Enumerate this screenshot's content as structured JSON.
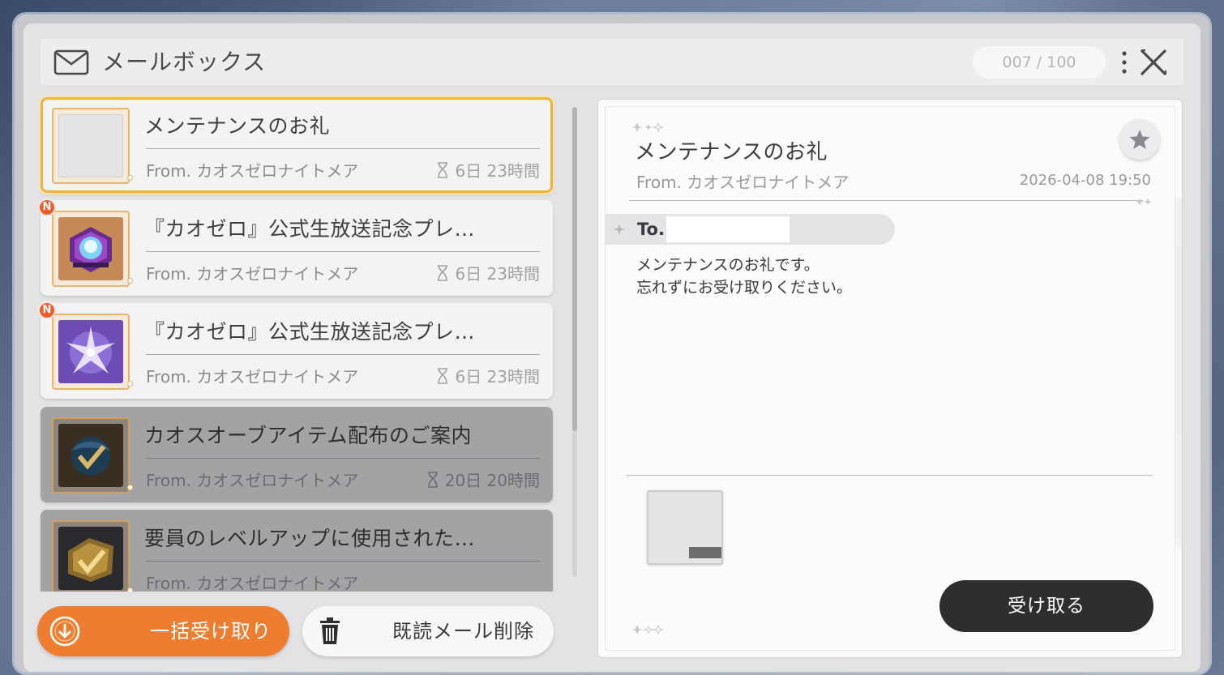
{
  "header": {
    "title": "メールボックス",
    "mail_count": "007 / 100"
  },
  "mails": [
    {
      "subject": "メンテナンスのお礼",
      "from": "From. カオスゼロナイトメア",
      "expires": "6日 23時間",
      "selected": true,
      "new": false,
      "read": false,
      "icon": "empty-item-icon"
    },
    {
      "subject": "『カオゼロ』公式生放送記念プレ…",
      "from": "From. カオスゼロナイトメア",
      "expires": "6日 23時間",
      "selected": false,
      "new": true,
      "new_badge": "N",
      "read": false,
      "icon": "crystal-device-icon"
    },
    {
      "subject": "『カオゼロ』公式生放送記念プレ…",
      "from": "From. カオスゼロナイトメア",
      "expires": "6日 23時間",
      "selected": false,
      "new": true,
      "new_badge": "N",
      "read": false,
      "icon": "star-shard-icon"
    },
    {
      "subject": "カオスオーブアイテム配布のご案内",
      "from": "From. カオスゼロナイトメア",
      "expires": "20日 20時間",
      "selected": false,
      "new": false,
      "read": true,
      "icon": "chaos-orb-check-icon"
    },
    {
      "subject": "要員のレベルアップに使用された…",
      "from": "From. カオスゼロナイトメア",
      "expires": "",
      "selected": false,
      "new": false,
      "read": true,
      "icon": "gold-check-icon"
    }
  ],
  "actions": {
    "bulk_receive": "一括受け取り",
    "delete_read": "既読メール削除"
  },
  "detail": {
    "subject": "メンテナンスのお礼",
    "from": "From. カオスゼロナイトメア",
    "date": "2026-04-08 19:50",
    "to_label": "To.",
    "to_value": "",
    "body_line1": "メンテナンスのお礼です。",
    "body_line2": "忘れずにお受け取りください。",
    "receive_button": "受け取る"
  },
  "colors": {
    "accent_orange": "#ef7d2f",
    "selected_border": "#f3b13d",
    "new_badge": "#ee5d2a",
    "receive_button": "#2e2e31"
  }
}
